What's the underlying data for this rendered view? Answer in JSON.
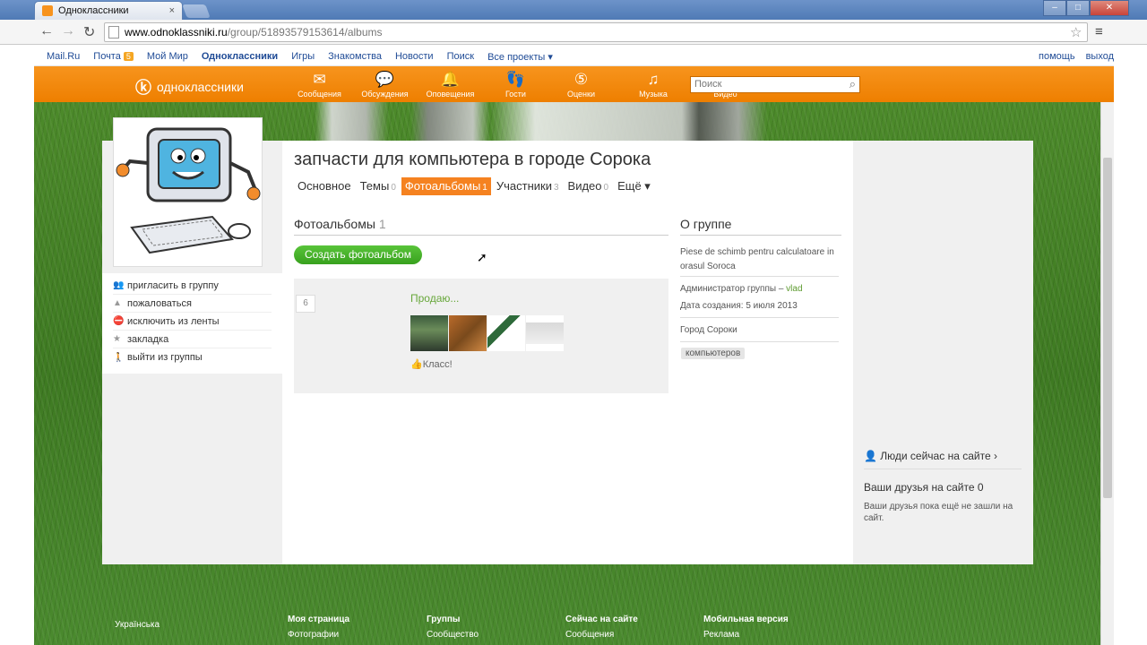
{
  "browser": {
    "tab_title": "Одноклассники",
    "tab_close": "×",
    "url_host": "www.odnoklassniki.ru",
    "url_path": "/group/51893579153614/albums"
  },
  "portal": {
    "links": [
      "Mail.Ru",
      "Почта",
      "Мой Мир",
      "Одноклассники",
      "Игры",
      "Знакомства",
      "Новости",
      "Поиск",
      "Все проекты ▾"
    ],
    "mail_badge": "5",
    "help": "помощь",
    "logout": "выход"
  },
  "ok": {
    "logo": "одноклассники",
    "nav": [
      {
        "label": "Сообщения",
        "icon": "✉"
      },
      {
        "label": "Обсуждения",
        "icon": "💬"
      },
      {
        "label": "Оповещения",
        "icon": "🔔"
      },
      {
        "label": "Гости",
        "icon": "👣"
      },
      {
        "label": "Оценки",
        "icon": "⑤"
      },
      {
        "label": "Музыка",
        "icon": "♫"
      },
      {
        "label": "Видео",
        "icon": "▭"
      }
    ],
    "search_placeholder": "Поиск"
  },
  "group": {
    "title": "запчасти для компьютера в городе Сорока",
    "tabs": [
      {
        "label": "Основное",
        "count": ""
      },
      {
        "label": "Темы",
        "count": "0"
      },
      {
        "label": "Фотоальбомы",
        "count": "1"
      },
      {
        "label": "Участники",
        "count": "3"
      },
      {
        "label": "Видео",
        "count": "0"
      },
      {
        "label": "Ещё ▾",
        "count": ""
      }
    ]
  },
  "sidebar": {
    "items": [
      {
        "label": "пригласить в группу",
        "icon": "👥"
      },
      {
        "label": "пожаловаться",
        "icon": "▲"
      },
      {
        "label": "исключить из ленты",
        "icon": "⛔"
      },
      {
        "label": "закладка",
        "icon": "★"
      },
      {
        "label": "выйти из группы",
        "icon": "🚶"
      }
    ]
  },
  "albums": {
    "heading": "Фотоальбомы",
    "count": "1",
    "create_button": "Создать фотоальбом",
    "album": {
      "photo_count": "6",
      "name": "Продаю...",
      "like": "Класс!"
    }
  },
  "about": {
    "heading": "О группе",
    "description": "Piese de schimb pentru calculatoare in orasul Soroca",
    "admin_label": "Администратор группы – ",
    "admin_name": "vlad",
    "created": "Дата создания: 5 июля 2013",
    "city": "Город Сороки",
    "tag": "компьютеров"
  },
  "online": {
    "people_now": "Люди сейчас на сайте ›",
    "friends_title": "Ваши друзья на сайте 0",
    "friends_text": "Ваши друзья пока ещё не зашли на сайт."
  },
  "footer": {
    "cols": [
      {
        "h": "",
        "l": "Українська"
      },
      {
        "h": "Моя страница",
        "l": "Фотографии"
      },
      {
        "h": "Группы",
        "l": "Сообщество"
      },
      {
        "h": "Сейчас на сайте",
        "l": "Сообщения"
      },
      {
        "h": "Мобильная версия",
        "l": "Реклама"
      }
    ]
  },
  "colors": {
    "ok_orange": "#f7941d",
    "create_green": "#3fae25",
    "album_link": "#67a73a"
  }
}
